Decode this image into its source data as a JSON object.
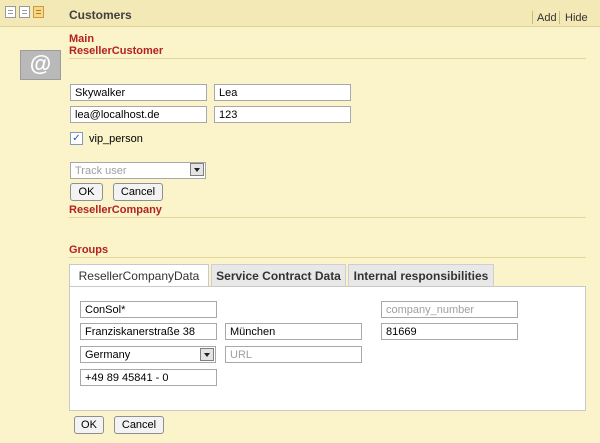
{
  "header": {
    "title": "Customers",
    "add_label": "Add",
    "hide_label": "Hide"
  },
  "sections": {
    "main": "Main",
    "reseller_customer": "ResellerCustomer",
    "reseller_company": "ResellerCompany",
    "groups": "Groups"
  },
  "avatar": {
    "symbol": "@"
  },
  "customer": {
    "last_name": "Skywalker",
    "first_name": "Lea",
    "email": "lea@localhost.de",
    "number": "123",
    "vip_checked": true,
    "vip_label": "vip_person",
    "track_user_placeholder": "Track user"
  },
  "buttons": {
    "ok": "OK",
    "cancel": "Cancel"
  },
  "tabs": [
    {
      "label": "ResellerCompanyData",
      "active": true
    },
    {
      "label": "Service Contract Data",
      "active": false
    },
    {
      "label": "Internal responsibilities",
      "active": false
    }
  ],
  "company": {
    "name": "ConSol*",
    "company_number_placeholder": "company_number",
    "street": "Franziskanerstraße 38",
    "city": "München",
    "zip": "81669",
    "country": "Germany",
    "url_placeholder": "URL",
    "phone": "+49 89 45841 - 0"
  },
  "colors": {
    "background": "#fbf3c9",
    "section_label": "#b22222",
    "header": "#f2e9b6"
  }
}
